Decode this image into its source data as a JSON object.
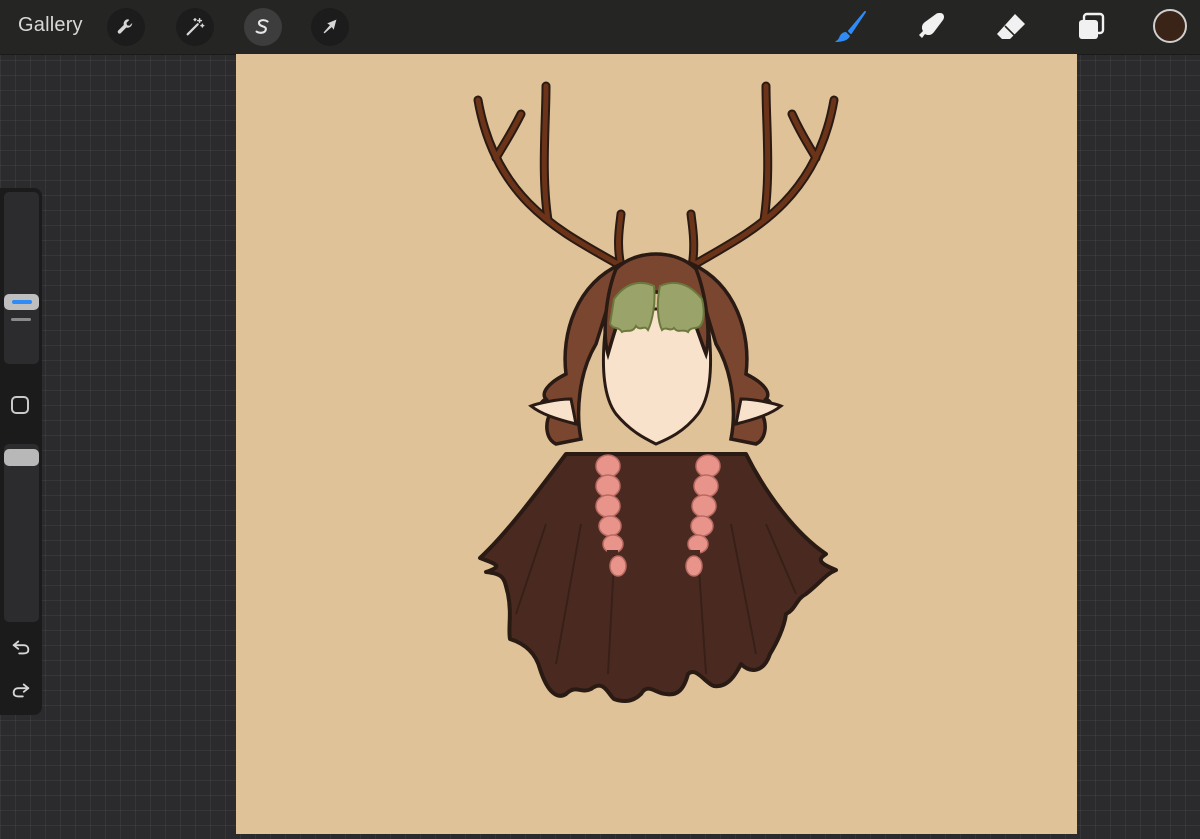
{
  "app": {
    "gallery_label": "Gallery"
  },
  "toolbar": {
    "left_tools": [
      {
        "name": "actions",
        "icon": "wrench-icon"
      },
      {
        "name": "adjustments",
        "icon": "magic-wand-icon"
      },
      {
        "name": "selection",
        "icon": "selection-s-icon",
        "active": true
      },
      {
        "name": "transform",
        "icon": "arrow-cursor-icon"
      }
    ],
    "right_tools": [
      {
        "name": "brush",
        "icon": "paintbrush-icon",
        "active": true,
        "accent": "#2f8bf5"
      },
      {
        "name": "smudge",
        "icon": "smudge-finger-icon"
      },
      {
        "name": "eraser",
        "icon": "eraser-icon"
      },
      {
        "name": "layers",
        "icon": "layers-icon"
      }
    ],
    "current_color": "#3a2418"
  },
  "sidebar": {
    "brush_size": 0.47,
    "opacity": 0.93,
    "modify_button": "square-icon",
    "undo": "undo-icon",
    "redo": "redo-icon"
  },
  "canvas": {
    "background_color": "#dfc298",
    "colors": {
      "antlers": "#6b3418",
      "hair": "#4a2a20",
      "hair_light": "#7a4630",
      "bangs": "#9aa46a",
      "skin": "#f9e2cc",
      "braids": "#e8948a",
      "outline": "#2a1a14"
    }
  }
}
